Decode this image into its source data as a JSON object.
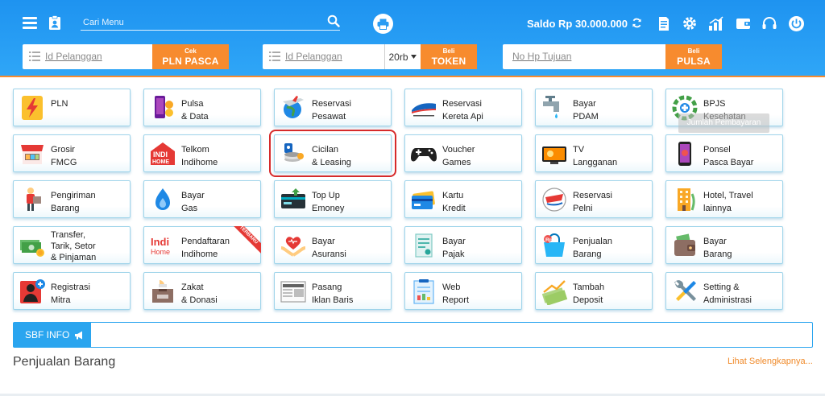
{
  "header": {
    "search": {
      "placeholder": "Cari Menu"
    },
    "saldo": "Saldo Rp 30.000.000"
  },
  "quickpay": {
    "pln": {
      "placeholder": "Id Pelanggan",
      "button_small": "Cek",
      "button_big": "PLN PASCA"
    },
    "token": {
      "placeholder": "Id Pelanggan",
      "denom": "20rb",
      "button_small": "Beli",
      "button_big": "TOKEN"
    },
    "pulsa": {
      "placeholder": "No Hp Tujuan",
      "button_small": "Beli",
      "button_big": "PULSA"
    }
  },
  "menu": {
    "pln": "PLN",
    "pulsa": "Pulsa\n& Data",
    "pesawat": "Reservasi\nPesawat",
    "kereta": "Reservasi\nKereta Api",
    "pdam": "Bayar\nPDAM",
    "bpjs": "BPJS\nKesehatan",
    "grosir": "Grosir\nFMCG",
    "telkom": "Telkom\nIndihome",
    "cicilan": "Cicilan\n& Leasing",
    "voucher": "Voucher\nGames",
    "tv": "TV\nLangganan",
    "ponsel": "Ponsel\nPasca Bayar",
    "pengiriman": "Pengiriman\nBarang",
    "gas": "Bayar\nGas",
    "emoney": "Top Up\nEmoney",
    "kartu": "Kartu\nKredit",
    "pelni": "Reservasi\nPelni",
    "hotel": "Hotel, Travel\nlainnya",
    "transfer": "Transfer,\nTarik, Setor\n& Pinjaman",
    "indihome_daftar": "Pendaftaran\nIndihome",
    "asuransi": "Bayar\nAsuransi",
    "pajak": "Bayar\nPajak",
    "penjualan": "Penjualan\nBarang",
    "bayar_barang": "Bayar\nBarang",
    "registrasi": "Registrasi\nMitra",
    "zakat": "Zakat\n& Donasi",
    "iklan": "Pasang\nIklan Baris",
    "report": "Web\nReport",
    "deposit": "Tambah\nDeposit",
    "setting": "Setting &\nAdministrasi"
  },
  "promo_ribbon": "TERBARU",
  "tooltip": "Jumlah Pembayaran",
  "info_bar": {
    "label": "SBF INFO"
  },
  "section": {
    "title": "Penjualan Barang",
    "see_more": "Lihat Selengkapnya..."
  },
  "colors": {
    "header_blue": "#1e93f0",
    "accent_orange": "#f78b2e",
    "tile_border": "#9fd4ea",
    "selected_outline": "#d62a2a"
  }
}
